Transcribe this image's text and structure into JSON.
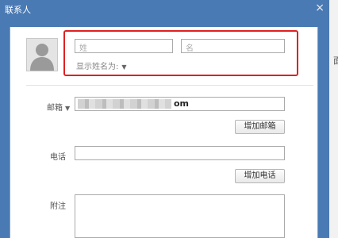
{
  "window": {
    "title": "联系人",
    "close_glyph": "×"
  },
  "background": {
    "ghost_text": "面"
  },
  "contact": {
    "last_name_placeholder": "姓",
    "first_name_placeholder": "名",
    "display_name_as": "显示姓名为:",
    "dropdown_glyph": "▼"
  },
  "email": {
    "label": "邮箱",
    "dropdown_glyph": "▼",
    "visible_tail": "om",
    "add_button": "增加邮箱"
  },
  "phone": {
    "label": "电话",
    "add_button": "增加电话"
  },
  "notes": {
    "label": "附注"
  },
  "colors": {
    "title_bar": "#4a7ab3",
    "highlight_border": "#e02020"
  },
  "icons": {
    "avatar": "person-placeholder-icon",
    "close": "close-icon",
    "dropdown": "chevron-down-icon"
  }
}
